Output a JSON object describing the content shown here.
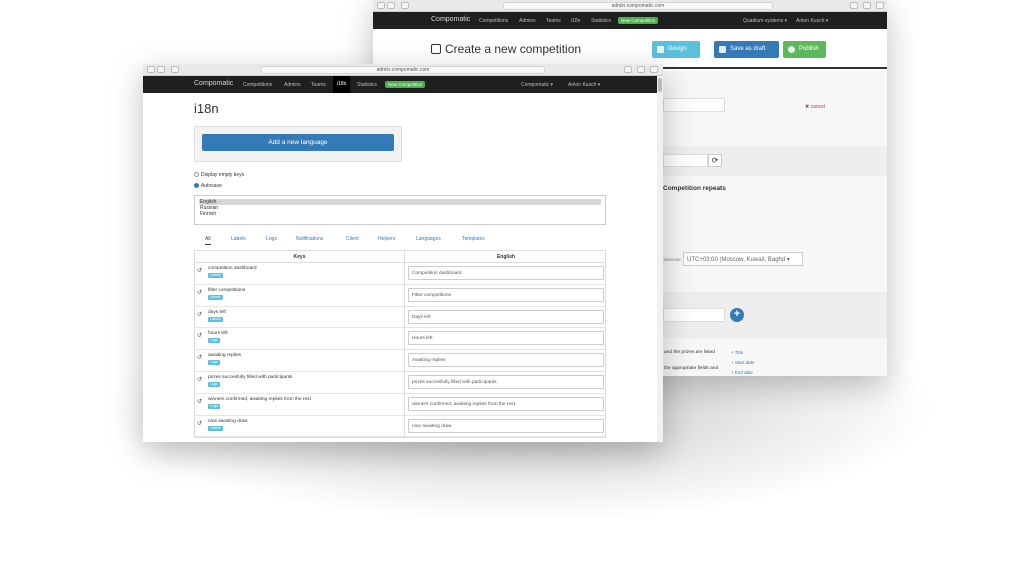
{
  "back_window": {
    "url": "admin.compomatic.com",
    "navbar": {
      "brand": "Compomatic",
      "items": [
        "Competitions",
        "Admins",
        "Teams",
        "i18n",
        "Statistics"
      ],
      "new_button": "New Competition",
      "org_menu": "Quadium-systems ▾",
      "user_menu": "Anton Kusch ▾"
    },
    "header": {
      "title": "Create a new competition",
      "design_label": "Design",
      "save_draft_label": "Save as draft",
      "publish_label": "Publish"
    },
    "form": {
      "cancel_label": "✖ cancel",
      "repeats_label": "Competition repeats",
      "timezone_label": "Timezone:",
      "timezone_value": "UTC+03:00 (Moscow, Kuwait, Baghd ▾",
      "prizes_text": "and the prizes are listed",
      "fields_text": "the appropriate fields and",
      "links": [
        "+ Title",
        "+ Start date",
        "+ End date"
      ]
    }
  },
  "front_window": {
    "url": "admin.compomatic.com",
    "navbar": {
      "brand": "Compomatic",
      "items": [
        "Competitions",
        "Admins",
        "Teams",
        "i18n",
        "Statistics"
      ],
      "new_button": "New Competition",
      "org_menu": "Compomatic ▾",
      "user_menu": "Anton Kusch ▾"
    },
    "page_title": "i18n",
    "add_language_label": "Add a new language",
    "options": {
      "empty_keys_label": "Display empty keys",
      "autosave_label": "Autosave"
    },
    "languages": [
      "English",
      "Russian",
      "Finnish"
    ],
    "tabs": [
      "All",
      "Labels",
      "Logs",
      "Notifications",
      "Client",
      "Helpers",
      "Languages",
      "Templates"
    ],
    "table": {
      "headers": [
        "Keys",
        "English"
      ],
      "rows": [
        {
          "key": "competition dashboard",
          "tag": "Labels",
          "value": "Competition dashboard"
        },
        {
          "key": "filter competitions",
          "tag": "Labels",
          "value": "Filter competitions"
        },
        {
          "key": "days left",
          "tag": "Labels",
          "value": "Days left"
        },
        {
          "key": "hours left",
          "tag": "Logs",
          "value": "Hours left"
        },
        {
          "key": "awaiting replies",
          "tag": "Logs",
          "value": "Awaiting replies"
        },
        {
          "key": "prizes succesfully filled with participants",
          "tag": "Logs",
          "value": "prizes succesfully filled with participants"
        },
        {
          "key": "winners confirmed, awaiting replies from the rest",
          "tag": "Logs",
          "value": "winners confirmed, awaiting replies from the rest"
        },
        {
          "key": "now awaiting draw",
          "tag": "Labels",
          "value": "now awaiting draw"
        }
      ]
    }
  },
  "colors": {
    "primary": "#337ab7",
    "info": "#5bc0de",
    "success": "#5cb85c",
    "navbar": "#1f1f1f"
  }
}
